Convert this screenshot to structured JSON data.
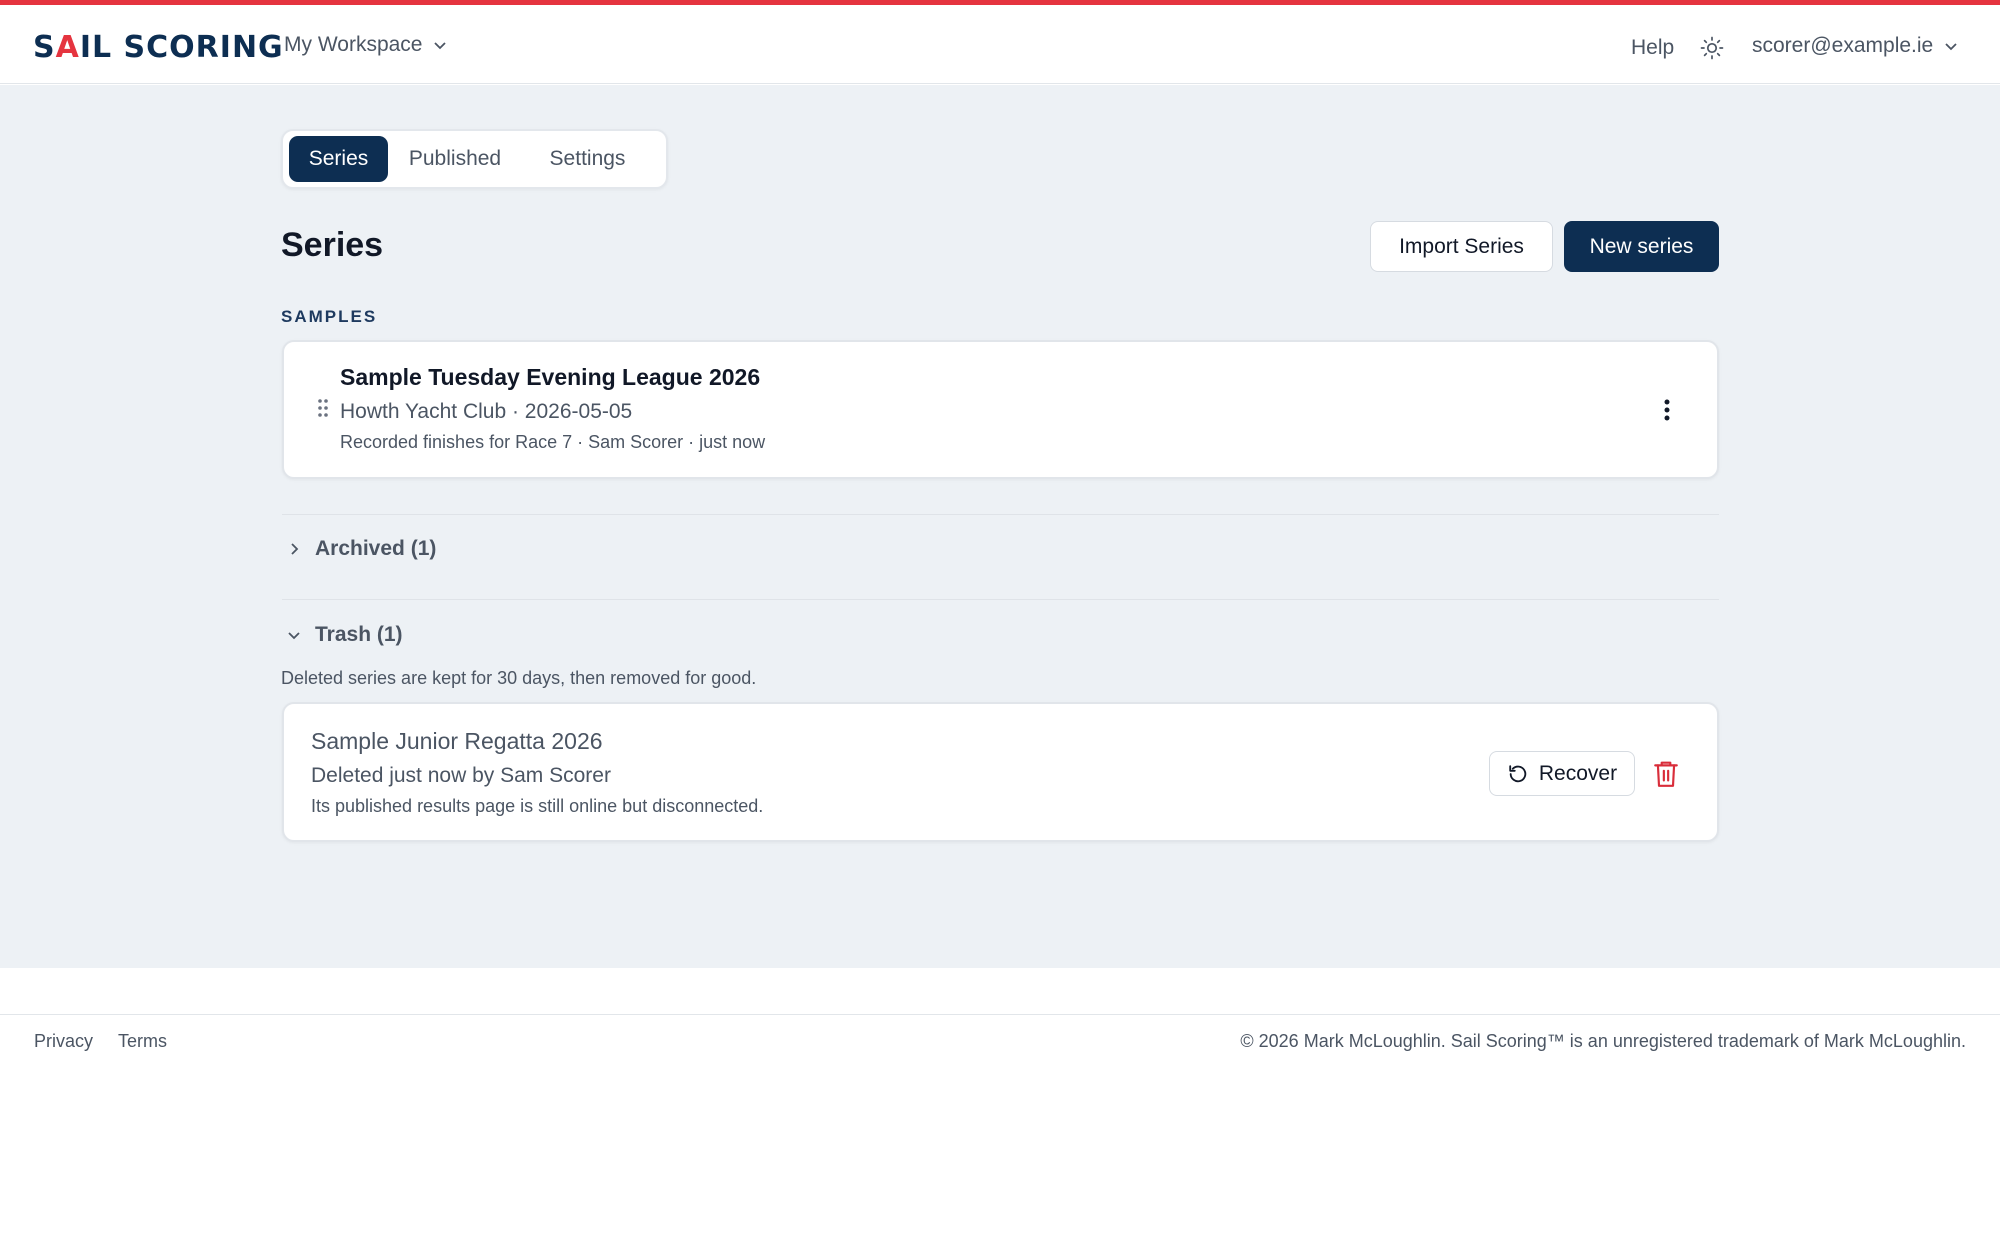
{
  "header": {
    "logo_text_prefix": "S",
    "logo_text_accent": "A",
    "logo_text_suffix": "IL SCORING",
    "workspace_label": "My Workspace",
    "help_label": "Help",
    "account_email": "scorer@example.ie"
  },
  "tabs": [
    {
      "label": "Series",
      "active": true
    },
    {
      "label": "Published",
      "active": false
    },
    {
      "label": "Settings",
      "active": false
    }
  ],
  "page": {
    "title": "Series",
    "import_label": "Import Series",
    "new_label": "New series"
  },
  "samples": {
    "section_label": "SAMPLES",
    "items": [
      {
        "title": "Sample Tuesday Evening League 2026",
        "subtitle": "Howth Yacht Club · 2026-05-05",
        "meta": "Recorded finishes for Race 7 · Sam Scorer · just now"
      }
    ]
  },
  "archived": {
    "label": "Archived (1)",
    "expanded": false
  },
  "trash": {
    "label": "Trash (1)",
    "expanded": true,
    "note": "Deleted series are kept for 30 days, then removed for good.",
    "items": [
      {
        "title": "Sample Junior Regatta 2026",
        "subtitle": "Deleted just now by Sam Scorer",
        "meta": "Its published results page is still online but disconnected.",
        "recover_label": "Recover"
      }
    ]
  },
  "footer": {
    "privacy_label": "Privacy",
    "terms_label": "Terms",
    "copyright": "© 2026 Mark McLoughlin. Sail Scoring™ is an unregistered trademark of Mark McLoughlin."
  },
  "colors": {
    "brand_navy": "#0d2e52",
    "brand_red": "#e5343f",
    "page_bg": "#edf1f5",
    "danger": "#d92d3a"
  },
  "icons": [
    "chevron-down-icon",
    "sun-icon",
    "drag-handle-icon",
    "more-vertical-icon",
    "chevron-right-icon",
    "refresh-icon",
    "trash-icon"
  ]
}
